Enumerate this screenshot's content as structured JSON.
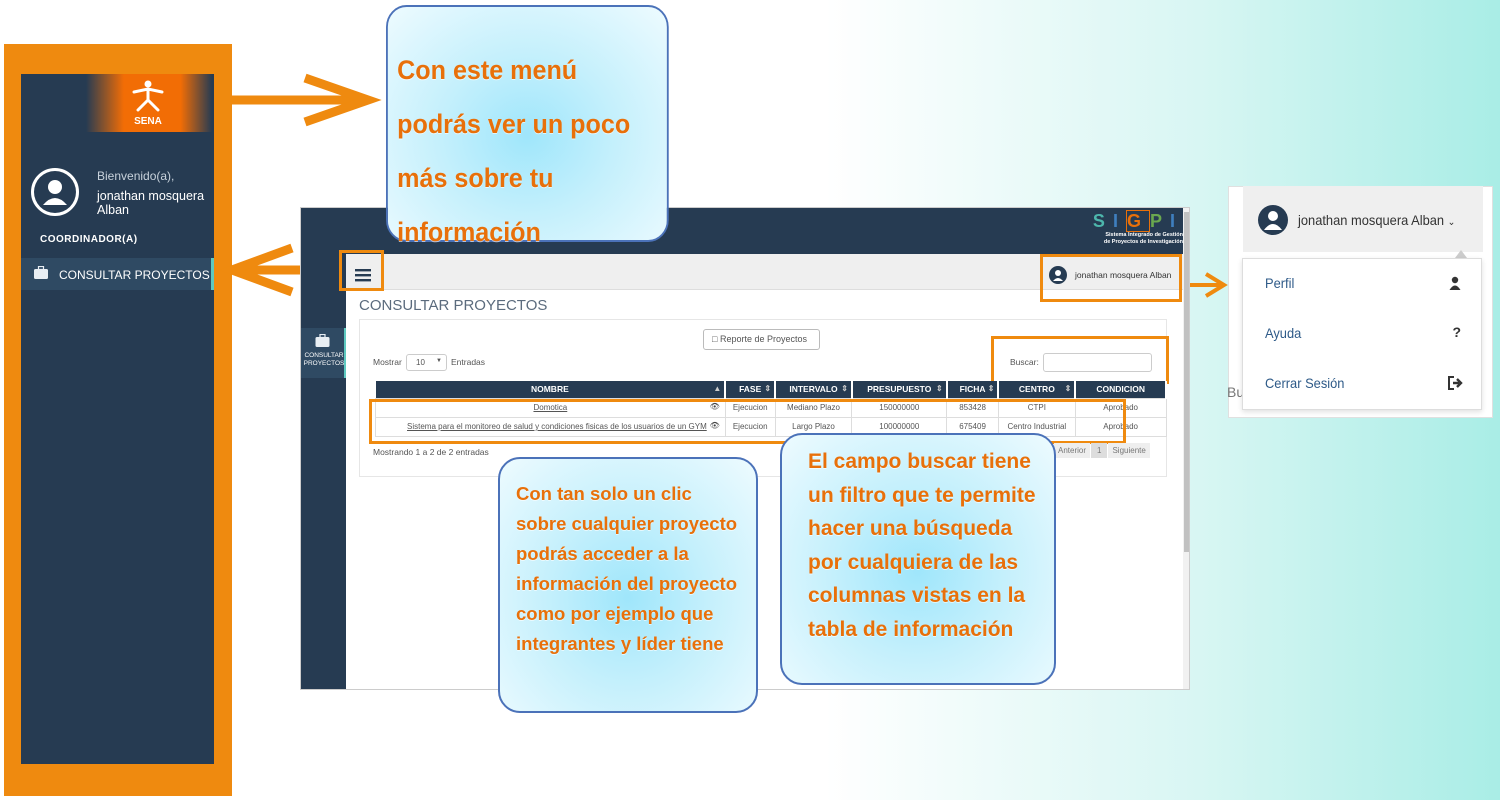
{
  "sidebar": {
    "logo_text": "SENA",
    "welcome": "Bienvenido(a),",
    "user_name": "jonathan mosquera Alban",
    "role": "COORDINADOR(A)",
    "menu_item": "CONSULTAR PROYECTOS",
    "icons": {
      "avatar": "user-circle-icon",
      "menu": "briefcase-icon"
    }
  },
  "callouts": {
    "menu_info": "Con este menú podrás ver un poco más sobre tu información",
    "project_click": "Con tan solo un clic sobre cualquier proyecto podrás acceder a la información del proyecto como por ejemplo que integrantes y líder tiene",
    "search_filter": "El campo buscar tiene un filtro que te permite hacer una búsqueda por cualquiera de las columnas vistas en la tabla de información"
  },
  "app": {
    "brand": {
      "letters": [
        "S",
        "I",
        "G",
        "P",
        "I"
      ],
      "letter_colors": [
        "#4db6ac",
        "#3f7fbf",
        "#e8700a",
        "#6aa84f",
        "#3f7fbf"
      ],
      "subtitle_line1": "Sistema Integrado de Gestión",
      "subtitle_line2": "de Proyectos de Investigación"
    },
    "side_item": "CONSULTAR PROYECTOS",
    "user_name": "jonathan mosquera Alban",
    "page_title": "CONSULTAR PROYECTOS",
    "report_button": "Reporte de Proyectos",
    "show_label": "Mostrar",
    "show_value": "10",
    "entries_label": "Entradas",
    "search_label": "Buscar:",
    "search_value": "",
    "table": {
      "headers": [
        "NOMBRE",
        "FASE",
        "INTERVALO",
        "PRESUPUESTO",
        "FICHA",
        "CENTRO",
        "CONDICION"
      ],
      "rows": [
        [
          "Domotica",
          "Ejecucion",
          "Mediano Plazo",
          "150000000",
          "853428",
          "CTPI",
          "Aprobado"
        ],
        [
          "Sistema para el monitoreo de salud y condiciones fisicas de los usuarios de un GYM",
          "Ejecucion",
          "Largo Plazo",
          "100000000",
          "675409",
          "Centro Industrial",
          "Aprobado"
        ]
      ]
    },
    "info": "Mostrando 1 a 2 de 2 entradas",
    "pager": {
      "prev": "Anterior",
      "page": "1",
      "next": "Siguiente"
    }
  },
  "dropdown": {
    "user_name": "jonathan mosquera Alban",
    "items": [
      {
        "label": "Perfil",
        "icon": "user-icon"
      },
      {
        "label": "Ayuda",
        "icon": "question-icon"
      },
      {
        "label": "Cerrar Sesión",
        "icon": "sign-out-icon"
      }
    ],
    "behind_text": "Bu"
  },
  "colors": {
    "accent": "#ef8a0f",
    "navy": "#263b52",
    "callout_border": "#4b72b9",
    "teal": "#5ec9c0"
  }
}
